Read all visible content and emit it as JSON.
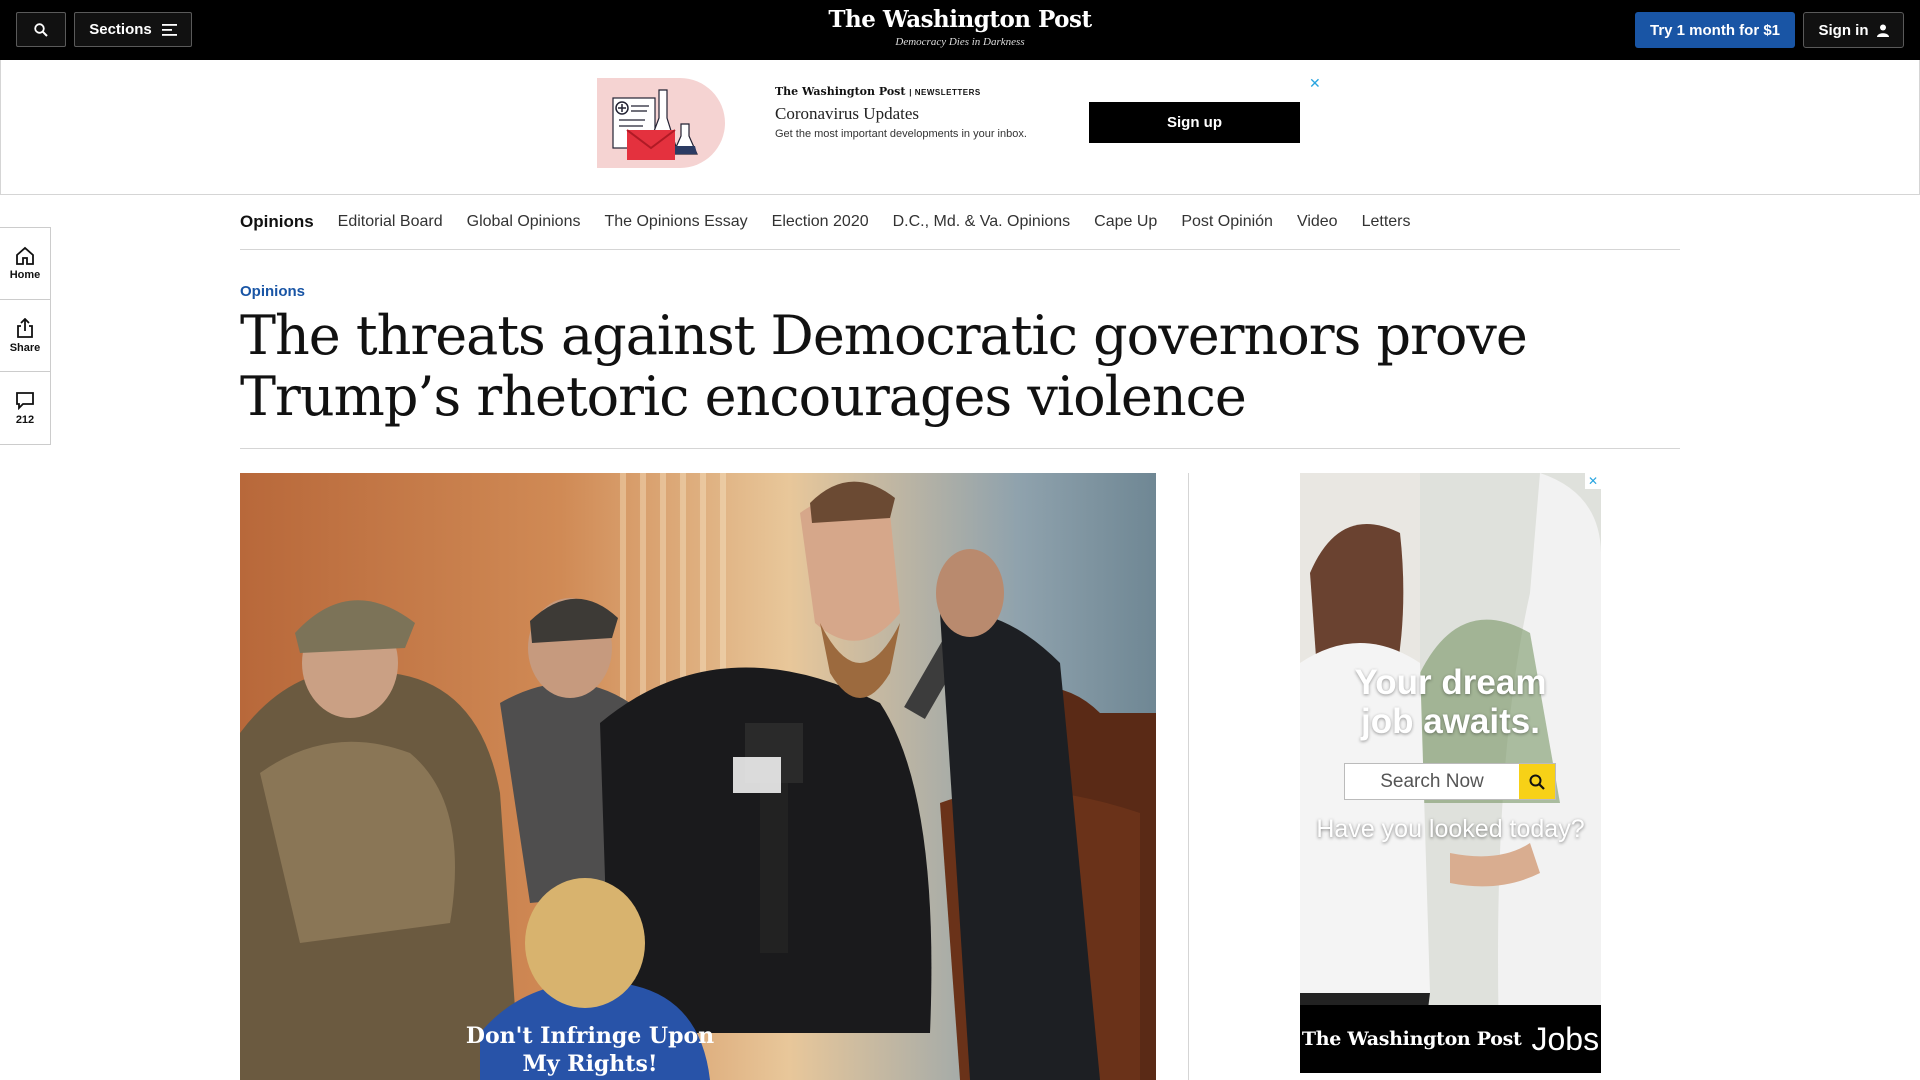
{
  "header": {
    "sections_label": "Sections",
    "logo": "The Washington Post",
    "tagline": "Democracy Dies in Darkness",
    "subscribe_label": "Try 1 month for $1",
    "signin_label": "Sign in"
  },
  "newsletter_ad": {
    "brand": "The Washington Post",
    "brand_tag": "NEWSLETTERS",
    "title": "Coronavirus Updates",
    "description": "Get the most important developments in your inbox.",
    "signup_label": "Sign up",
    "close_glyph": "✕"
  },
  "section_nav": {
    "items": [
      "Opinions",
      "Editorial Board",
      "Global Opinions",
      "The Opinions Essay",
      "Election 2020",
      "D.C., Md. & Va. Opinions",
      "Cape Up",
      "Post Opinión",
      "Video",
      "Letters"
    ]
  },
  "rail": {
    "home_label": "Home",
    "share_label": "Share",
    "comments_count": "212"
  },
  "article": {
    "kicker": "Opinions",
    "headline": "The threats against Democratic governors prove Trump’s rhetoric encourages violence",
    "photo_caption_text": "Don't Infringe Upon My Rights!"
  },
  "jobs_ad": {
    "close_glyph": "✕",
    "headline_line1": "Your dream",
    "headline_line2": "job awaits.",
    "search_placeholder": "Search Now",
    "tagline": "Have you looked today?",
    "brand": "The Washington Post",
    "jobs_label": "Jobs"
  },
  "colors": {
    "brand_blue": "#1955a5",
    "topbar": "#000000",
    "jobs_search_button": "#f7d117"
  }
}
